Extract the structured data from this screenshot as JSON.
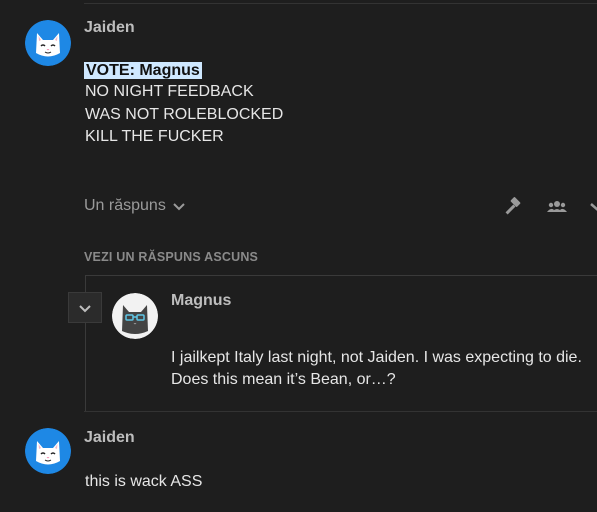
{
  "post1": {
    "username": "Jaiden",
    "vote_text": "VOTE: Magnus",
    "lines": [
      "NO NIGHT FEEDBACK",
      "WAS NOT ROLEBLOCKED",
      "KILL THE FUCKER"
    ],
    "replies_label": "Un răspuns",
    "icons": [
      "gavel-icon",
      "users-icon",
      "chevron-down-icon"
    ]
  },
  "hidden_replies_label": "VEZI UN RĂSPUNS ASCUNS",
  "reply": {
    "username": "Magnus",
    "lines": [
      "I jailkept Italy last night, not Jaiden. I was expecting to die.",
      "Does this mean it’s Bean, or…?"
    ]
  },
  "post2": {
    "username": "Jaiden",
    "text": "this is wack ASS"
  },
  "colors": {
    "avatar_blue": "#1e88e5",
    "highlight": "#cfe8ff"
  }
}
